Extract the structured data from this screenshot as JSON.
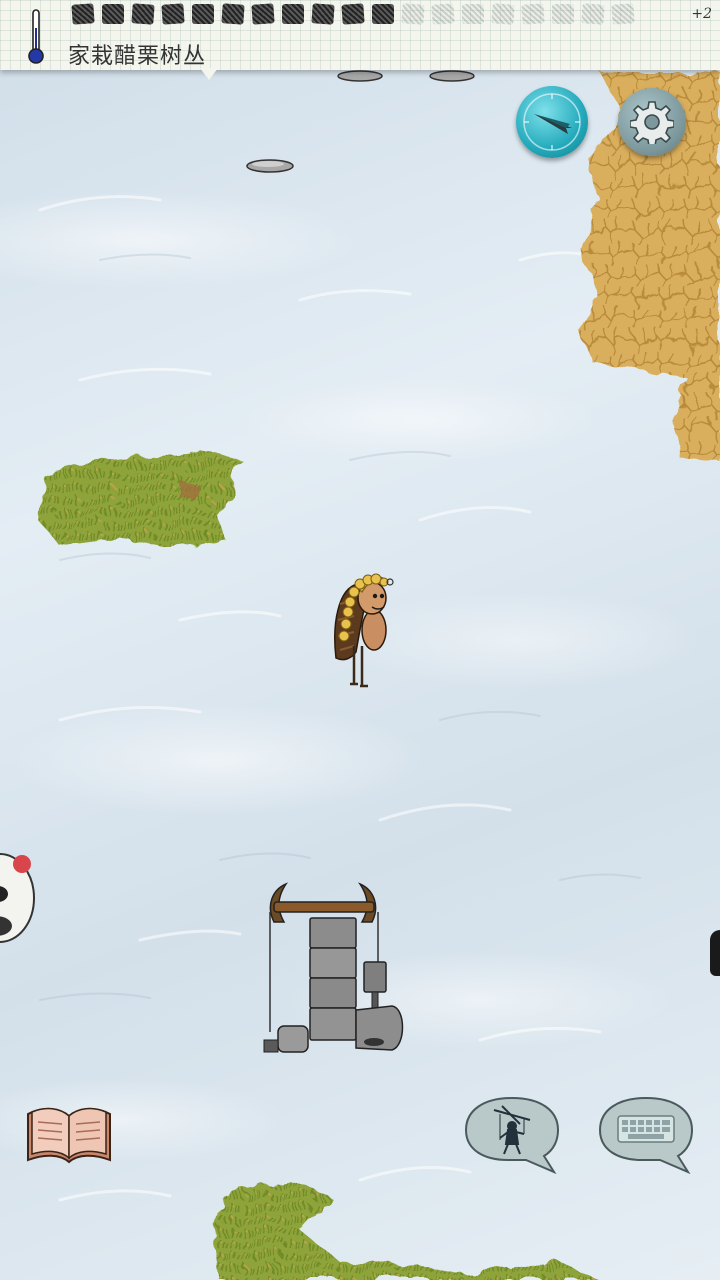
{
  "hud": {
    "hover_label": "家栽醋栗树丛",
    "yum_bonus": "+2",
    "food": {
      "filled": 11,
      "total": 19
    }
  },
  "icons": {
    "thermometer": "thermometer-icon",
    "compass": "compass-icon",
    "settings": "gear-icon",
    "tech_tree": "open-book-icon",
    "emote": "puppet-icon",
    "keyboard": "keyboard-icon"
  },
  "colors": {
    "snow": "#dde7ef",
    "compass": "#22a9bb",
    "settings": "#7c989c",
    "desert": "#d8ab5a",
    "grass": "#8ca238"
  }
}
